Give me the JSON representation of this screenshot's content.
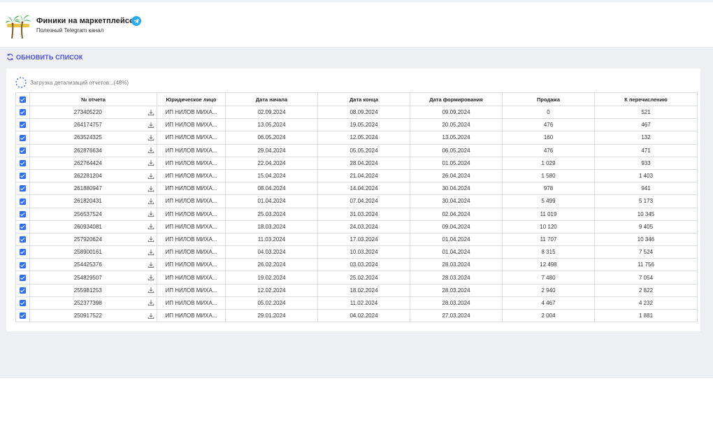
{
  "header": {
    "title": "Финики на маркетплейсе",
    "subtitle": "Полезный Telegram канал",
    "logo_icon": "palm-tree-logo",
    "telegram_icon": "telegram-icon",
    "telegram_color": "#2AABEE"
  },
  "toolbar": {
    "refresh_label": "ОБНОВИТЬ СПИСОК",
    "refresh_icon": "refresh-icon",
    "accent_color": "#4a4ae0"
  },
  "loading": {
    "text": "Загрузка детализаций отчетов...(48%)",
    "progress_percent": 48
  },
  "table": {
    "columns": [
      "№ отчета",
      "Юридическое лицо",
      "Дата начала",
      "Дата конца",
      "Дата формирования",
      "Продажа",
      "К перечислению"
    ],
    "rows": [
      {
        "id": "273405220",
        "entity": "ИП НИЛОВ МИХА...",
        "start": "02.09.2024",
        "end": "08.09.2024",
        "formed": "09.09.2024",
        "sale": "0",
        "payout": "521"
      },
      {
        "id": "264174757",
        "entity": "ИП НИЛОВ МИХА...",
        "start": "13.05.2024",
        "end": "19.05.2024",
        "formed": "20.05.2024",
        "sale": "476",
        "payout": "467"
      },
      {
        "id": "263524325",
        "entity": "ИП НИЛОВ МИХА...",
        "start": "06.05.2024",
        "end": "12.05.2024",
        "formed": "13.05.2024",
        "sale": "160",
        "payout": "132"
      },
      {
        "id": "262876634",
        "entity": "ИП НИЛОВ МИХА...",
        "start": "29.04.2024",
        "end": "05.05.2024",
        "formed": "06.05.2024",
        "sale": "476",
        "payout": "471"
      },
      {
        "id": "262764424",
        "entity": "ИП НИЛОВ МИХА...",
        "start": "22.04.2024",
        "end": "28.04.2024",
        "formed": "01.05.2024",
        "sale": "1 029",
        "payout": "933"
      },
      {
        "id": "262281204",
        "entity": "ИП НИЛОВ МИХА...",
        "start": "15.04.2024",
        "end": "21.04.2024",
        "formed": "26.04.2024",
        "sale": "1 580",
        "payout": "1 403"
      },
      {
        "id": "261880947",
        "entity": "ИП НИЛОВ МИХА...",
        "start": "08.04.2024",
        "end": "14.04.2024",
        "formed": "30.04.2024",
        "sale": "978",
        "payout": "941"
      },
      {
        "id": "261820431",
        "entity": "ИП НИЛОВ МИХА...",
        "start": "01.04.2024",
        "end": "07.04.2024",
        "formed": "30.04.2024",
        "sale": "5 499",
        "payout": "5 173"
      },
      {
        "id": "256537524",
        "entity": "ИП НИЛОВ МИХА...",
        "start": "25.03.2024",
        "end": "31.03.2024",
        "formed": "02.04.2024",
        "sale": "11 019",
        "payout": "10 345"
      },
      {
        "id": "260934081",
        "entity": "ИП НИЛОВ МИХА...",
        "start": "18.03.2024",
        "end": "24.03.2024",
        "formed": "09.04.2024",
        "sale": "10 120",
        "payout": "9 405"
      },
      {
        "id": "257920624",
        "entity": "ИП НИЛОВ МИХА...",
        "start": "11.03.2024",
        "end": "17.03.2024",
        "formed": "01.04.2024",
        "sale": "11 707",
        "payout": "10 346"
      },
      {
        "id": "258900161",
        "entity": "ИП НИЛОВ МИХА...",
        "start": "04.03.2024",
        "end": "10.03.2024",
        "formed": "01.04.2024",
        "sale": "8 315",
        "payout": "7 524"
      },
      {
        "id": "254425376",
        "entity": "ИП НИЛОВ МИХА...",
        "start": "26.02.2024",
        "end": "03.03.2024",
        "formed": "28.03.2024",
        "sale": "12 498",
        "payout": "11 756"
      },
      {
        "id": "254829507",
        "entity": "ИП НИЛОВ МИХА...",
        "start": "19.02.2024",
        "end": "25.02.2024",
        "formed": "28.03.2024",
        "sale": "7 480",
        "payout": "7 054"
      },
      {
        "id": "255981253",
        "entity": "ИП НИЛОВ МИХА...",
        "start": "12.02.2024",
        "end": "18.02.2024",
        "formed": "28.03.2024",
        "sale": "2 940",
        "payout": "2 822"
      },
      {
        "id": "252377398",
        "entity": "ИП НИЛОВ МИХА...",
        "start": "05.02.2024",
        "end": "11.02.2024",
        "formed": "28.03.2024",
        "sale": "4 467",
        "payout": "4 232"
      },
      {
        "id": "250917522",
        "entity": "ИП НИЛОВ МИХА...",
        "start": "29.01.2024",
        "end": "04.02.2024",
        "formed": "27.03.2024",
        "sale": "2 004",
        "payout": "1 881"
      }
    ],
    "checkbox_color": "#2f6df2",
    "download_icon": "download-icon"
  }
}
